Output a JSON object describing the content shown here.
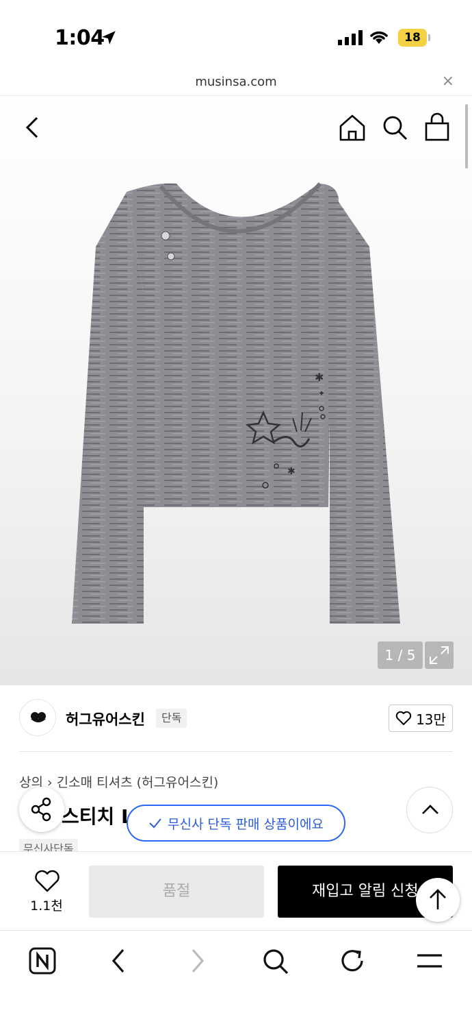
{
  "status_bar": {
    "time": "1:04",
    "battery": "18"
  },
  "browser": {
    "url": "musinsa.com",
    "close_glyph": "×"
  },
  "header_icons": [
    "back-icon",
    "home-icon",
    "search-icon",
    "cart-icon"
  ],
  "gallery": {
    "counter": "1 / 5"
  },
  "brand": {
    "name": "허그유어스킨",
    "tag": "단독",
    "likes": "13만"
  },
  "breadcrumb": {
    "category": "상의",
    "separator": "›",
    "subcategory": "긴소매 티셔츠 (허그유어스킨)"
  },
  "product": {
    "title_visible": "스티치 L",
    "exclusive_tag": "무신사단독"
  },
  "toast": {
    "text": "무신사 단독 판매 상품이에요"
  },
  "buy_bar": {
    "wish_count": "1.1천",
    "soldout_label": "품절",
    "restock_label": "재입고 알림 신청"
  },
  "colors": {
    "accent_blue": "#2b66f6",
    "battery_yellow": "#f4d142",
    "buy_black": "#000000"
  }
}
